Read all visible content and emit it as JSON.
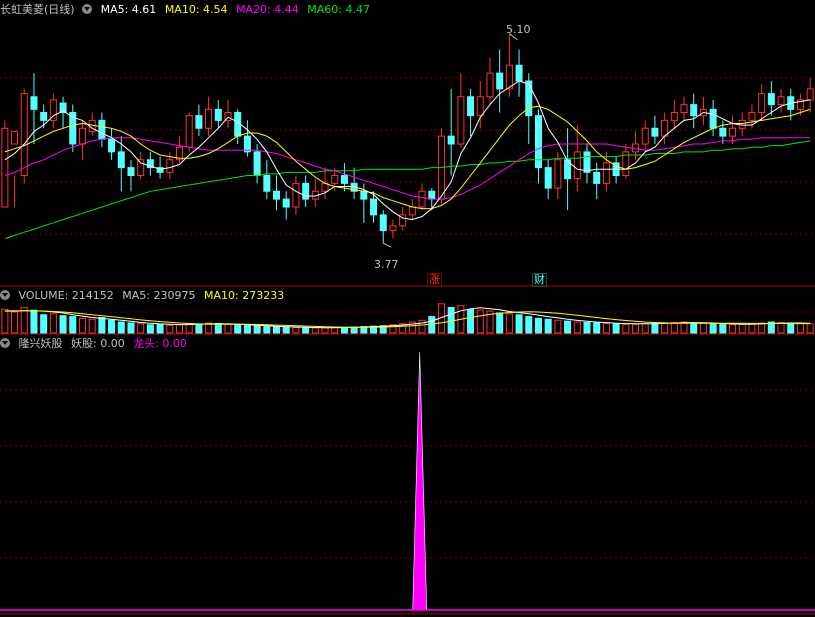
{
  "colors": {
    "up": "#ff3232",
    "down": "#54ffff",
    "ma5": "#ffffff",
    "ma10": "#ffff00",
    "ma20": "#ff00ff",
    "ma60": "#00e600",
    "grid": "#7a0000",
    "text": "#c0c0c0",
    "magenta": "#ff00ff"
  },
  "header_price": {
    "title": "长虹美菱(日线)",
    "ma5": "MA5: 4.61",
    "ma10": "MA10: 4.54",
    "ma20": "MA20: 4.44",
    "ma60": "MA60: 4.47"
  },
  "header_volume": {
    "label": "VOLUME: 214152",
    "ma5": "MA5: 230975",
    "ma10": "MA10: 273233"
  },
  "header_indicator": {
    "name": "隆兴妖股",
    "yaogu": "妖股: 0.00",
    "longtou": "龙头: 0.00"
  },
  "annotations": {
    "high_label": "5.10",
    "low_label": "3.77",
    "tag_zhang": "涨",
    "tag_cai": "财"
  },
  "chart_data": [
    {
      "type": "candlestick",
      "ylim": [
        3.6,
        5.2
      ],
      "high": 5.1,
      "low": 3.77,
      "candles": [
        [
          4.0,
          4.5,
          4.3,
          4.55
        ],
        [
          4.4,
          4.48,
          4.0,
          4.2
        ],
        [
          4.2,
          4.72,
          4.15,
          4.75
        ],
        [
          4.7,
          4.62,
          4.4,
          4.85
        ],
        [
          4.6,
          4.55,
          4.5,
          4.65
        ],
        [
          4.55,
          4.68,
          4.5,
          4.72
        ],
        [
          4.66,
          4.6,
          4.5,
          4.7
        ],
        [
          4.6,
          4.4,
          4.35,
          4.65
        ],
        [
          4.4,
          4.5,
          4.3,
          4.55
        ],
        [
          4.48,
          4.55,
          4.45,
          4.6
        ],
        [
          4.55,
          4.43,
          4.38,
          4.6
        ],
        [
          4.43,
          4.35,
          4.3,
          4.5
        ],
        [
          4.35,
          4.25,
          4.1,
          4.45
        ],
        [
          4.25,
          4.2,
          4.1,
          4.3
        ],
        [
          4.2,
          4.3,
          4.18,
          4.35
        ],
        [
          4.3,
          4.25,
          4.2,
          4.35
        ],
        [
          4.25,
          4.22,
          4.18,
          4.32
        ],
        [
          4.22,
          4.3,
          4.18,
          4.35
        ],
        [
          4.3,
          4.38,
          4.28,
          4.45
        ],
        [
          4.38,
          4.58,
          4.35,
          4.6
        ],
        [
          4.58,
          4.5,
          4.45,
          4.65
        ],
        [
          4.5,
          4.62,
          4.45,
          4.7
        ],
        [
          4.62,
          4.55,
          4.5,
          4.68
        ],
        [
          4.55,
          4.6,
          4.5,
          4.68
        ],
        [
          4.6,
          4.45,
          4.4,
          4.62
        ],
        [
          4.45,
          4.35,
          4.32,
          4.55
        ],
        [
          4.35,
          4.2,
          4.15,
          4.4
        ],
        [
          4.2,
          4.1,
          4.05,
          4.3
        ],
        [
          4.1,
          4.05,
          3.98,
          4.2
        ],
        [
          4.05,
          4.0,
          3.92,
          4.1
        ],
        [
          4.0,
          4.15,
          3.95,
          4.2
        ],
        [
          4.15,
          4.05,
          4.0,
          4.2
        ],
        [
          4.05,
          4.1,
          4.0,
          4.18
        ],
        [
          4.1,
          4.15,
          4.05,
          4.25
        ],
        [
          4.15,
          4.2,
          4.1,
          4.25
        ],
        [
          4.2,
          4.15,
          4.1,
          4.28
        ],
        [
          4.15,
          4.1,
          4.05,
          4.25
        ],
        [
          4.1,
          4.05,
          3.9,
          4.15
        ],
        [
          4.05,
          3.95,
          3.9,
          4.1
        ],
        [
          3.95,
          3.85,
          3.77,
          3.98
        ],
        [
          3.85,
          3.88,
          3.8,
          3.92
        ],
        [
          3.88,
          3.95,
          3.85,
          4.0
        ],
        [
          3.95,
          4.0,
          3.92,
          4.05
        ],
        [
          4.0,
          4.1,
          3.98,
          4.15
        ],
        [
          4.1,
          4.05,
          3.98,
          4.12
        ],
        [
          4.05,
          4.45,
          4.02,
          4.5
        ],
        [
          4.45,
          4.4,
          4.2,
          4.75
        ],
        [
          4.4,
          4.7,
          4.38,
          4.85
        ],
        [
          4.7,
          4.58,
          4.45,
          4.75
        ],
        [
          4.58,
          4.7,
          4.5,
          4.8
        ],
        [
          4.7,
          4.85,
          4.65,
          4.95
        ],
        [
          4.85,
          4.75,
          4.6,
          5.0
        ],
        [
          4.75,
          4.9,
          4.7,
          5.1
        ],
        [
          4.9,
          4.8,
          4.7,
          5.0
        ],
        [
          4.8,
          4.58,
          4.4,
          4.85
        ],
        [
          4.58,
          4.25,
          4.15,
          4.62
        ],
        [
          4.25,
          4.12,
          4.05,
          4.3
        ],
        [
          4.12,
          4.3,
          4.05,
          4.35
        ],
        [
          4.3,
          4.18,
          3.98,
          4.5
        ],
        [
          4.18,
          4.35,
          4.1,
          4.52
        ],
        [
          4.35,
          4.22,
          4.15,
          4.4
        ],
        [
          4.22,
          4.15,
          4.05,
          4.28
        ],
        [
          4.15,
          4.28,
          4.1,
          4.35
        ],
        [
          4.28,
          4.2,
          4.15,
          4.32
        ],
        [
          4.2,
          4.35,
          4.18,
          4.4
        ],
        [
          4.35,
          4.4,
          4.3,
          4.48
        ],
        [
          4.4,
          4.5,
          4.35,
          4.55
        ],
        [
          4.5,
          4.45,
          4.4,
          4.58
        ],
        [
          4.45,
          4.55,
          4.4,
          4.6
        ],
        [
          4.55,
          4.6,
          4.5,
          4.68
        ],
        [
          4.6,
          4.65,
          4.55,
          4.7
        ],
        [
          4.65,
          4.58,
          4.5,
          4.72
        ],
        [
          4.58,
          4.62,
          4.52,
          4.7
        ],
        [
          4.62,
          4.5,
          4.45,
          4.68
        ],
        [
          4.5,
          4.45,
          4.4,
          4.55
        ],
        [
          4.45,
          4.5,
          4.4,
          4.58
        ],
        [
          4.5,
          4.55,
          4.45,
          4.6
        ],
        [
          4.55,
          4.6,
          4.5,
          4.65
        ],
        [
          4.6,
          4.72,
          4.55,
          4.78
        ],
        [
          4.72,
          4.65,
          4.58,
          4.8
        ],
        [
          4.65,
          4.7,
          4.6,
          4.75
        ],
        [
          4.7,
          4.62,
          4.55,
          4.75
        ],
        [
          4.62,
          4.68,
          4.58,
          4.72
        ],
        [
          4.68,
          4.75,
          4.6,
          4.82
        ]
      ],
      "ma5": [
        4.3,
        4.34,
        4.4,
        4.48,
        4.52,
        4.58,
        4.61,
        4.57,
        4.55,
        4.5,
        4.47,
        4.44,
        4.4,
        4.35,
        4.28,
        4.26,
        4.24,
        4.25,
        4.27,
        4.33,
        4.38,
        4.44,
        4.5,
        4.57,
        4.54,
        4.49,
        4.43,
        4.35,
        4.24,
        4.14,
        4.1,
        4.07,
        4.07,
        4.09,
        4.13,
        4.13,
        4.13,
        4.11,
        4.08,
        4.02,
        3.97,
        3.93,
        3.92,
        3.94,
        3.99,
        4.07,
        4.16,
        4.34,
        4.44,
        4.57,
        4.65,
        4.72,
        4.76,
        4.8,
        4.78,
        4.66,
        4.5,
        4.41,
        4.29,
        4.24,
        4.23,
        4.24,
        4.24,
        4.24,
        4.24,
        4.28,
        4.35,
        4.38,
        4.45,
        4.5,
        4.55,
        4.56,
        4.6,
        4.59,
        4.56,
        4.53,
        4.52,
        4.52,
        4.56,
        4.6,
        4.64,
        4.66,
        4.67,
        4.68
      ],
      "ma10": [
        4.35,
        4.37,
        4.39,
        4.42,
        4.45,
        4.48,
        4.5,
        4.52,
        4.53,
        4.52,
        4.51,
        4.5,
        4.48,
        4.45,
        4.4,
        4.36,
        4.33,
        4.32,
        4.31,
        4.31,
        4.32,
        4.34,
        4.37,
        4.41,
        4.45,
        4.47,
        4.47,
        4.45,
        4.41,
        4.35,
        4.29,
        4.24,
        4.19,
        4.15,
        4.13,
        4.12,
        4.11,
        4.1,
        4.09,
        4.06,
        4.04,
        4.02,
        4.0,
        3.99,
        3.99,
        4.01,
        4.05,
        4.12,
        4.2,
        4.28,
        4.36,
        4.44,
        4.52,
        4.58,
        4.63,
        4.64,
        4.62,
        4.58,
        4.54,
        4.48,
        4.42,
        4.35,
        4.3,
        4.26,
        4.24,
        4.25,
        4.27,
        4.29,
        4.33,
        4.37,
        4.41,
        4.44,
        4.47,
        4.5,
        4.52,
        4.53,
        4.53,
        4.54,
        4.55,
        4.56,
        4.57,
        4.58,
        4.6,
        4.62
      ],
      "ma20": [
        4.2,
        4.22,
        4.25,
        4.28,
        4.3,
        4.33,
        4.36,
        4.38,
        4.4,
        4.42,
        4.43,
        4.44,
        4.44,
        4.44,
        4.43,
        4.42,
        4.41,
        4.4,
        4.39,
        4.38,
        4.37,
        4.36,
        4.36,
        4.36,
        4.36,
        4.36,
        4.36,
        4.35,
        4.34,
        4.32,
        4.3,
        4.28,
        4.26,
        4.24,
        4.23,
        4.21,
        4.19,
        4.17,
        4.15,
        4.13,
        4.11,
        4.09,
        4.07,
        4.06,
        4.05,
        4.05,
        4.06,
        4.08,
        4.11,
        4.14,
        4.18,
        4.22,
        4.26,
        4.3,
        4.34,
        4.37,
        4.39,
        4.4,
        4.4,
        4.4,
        4.4,
        4.4,
        4.4,
        4.39,
        4.38,
        4.37,
        4.36,
        4.36,
        4.37,
        4.38,
        4.39,
        4.4,
        4.4,
        4.41,
        4.42,
        4.42,
        4.43,
        4.43,
        4.44,
        4.44,
        4.44,
        4.44,
        4.44,
        4.44
      ],
      "ma60": [
        3.8,
        3.82,
        3.84,
        3.86,
        3.88,
        3.9,
        3.92,
        3.94,
        3.96,
        3.98,
        4.0,
        4.02,
        4.04,
        4.06,
        4.08,
        4.1,
        4.11,
        4.12,
        4.13,
        4.14,
        4.15,
        4.16,
        4.17,
        4.18,
        4.19,
        4.2,
        4.2,
        4.21,
        4.21,
        4.22,
        4.22,
        4.22,
        4.22,
        4.23,
        4.23,
        4.23,
        4.23,
        4.24,
        4.24,
        4.24,
        4.24,
        4.24,
        4.24,
        4.24,
        4.25,
        4.25,
        4.26,
        4.26,
        4.27,
        4.27,
        4.28,
        4.28,
        4.29,
        4.29,
        4.3,
        4.3,
        4.3,
        4.31,
        4.31,
        4.31,
        4.32,
        4.32,
        4.32,
        4.32,
        4.33,
        4.33,
        4.33,
        4.34,
        4.34,
        4.34,
        4.35,
        4.35,
        4.35,
        4.36,
        4.36,
        4.37,
        4.37,
        4.38,
        4.38,
        4.39,
        4.39,
        4.4,
        4.41,
        4.42
      ]
    },
    {
      "type": "bar",
      "series": "volume",
      "values": [
        260,
        230,
        280,
        250,
        200,
        210,
        190,
        180,
        160,
        150,
        170,
        140,
        120,
        110,
        100,
        90,
        95,
        85,
        90,
        95,
        100,
        110,
        105,
        95,
        90,
        85,
        80,
        75,
        70,
        65,
        60,
        58,
        55,
        55,
        60,
        62,
        65,
        70,
        75,
        80,
        90,
        100,
        120,
        140,
        180,
        320,
        280,
        300,
        260,
        250,
        240,
        220,
        210,
        200,
        180,
        160,
        150,
        140,
        130,
        120,
        115,
        110,
        105,
        100,
        95,
        95,
        100,
        105,
        110,
        115,
        120,
        110,
        105,
        100,
        95,
        90,
        95,
        100,
        110,
        120,
        115,
        110,
        105,
        100
      ],
      "ma5": [
        240,
        240,
        245,
        245,
        240,
        230,
        220,
        200,
        185,
        170,
        160,
        150,
        140,
        128,
        115,
        108,
        100,
        95,
        92,
        92,
        95,
        100,
        102,
        100,
        98,
        92,
        86,
        80,
        75,
        70,
        66,
        62,
        60,
        58,
        58,
        60,
        63,
        66,
        70,
        74,
        80,
        88,
        98,
        110,
        130,
        170,
        208,
        244,
        264,
        276,
        266,
        254,
        236,
        224,
        212,
        196,
        180,
        166,
        150,
        138,
        128,
        120,
        114,
        108,
        103,
        101,
        101,
        102,
        105,
        109,
        114,
        114,
        113,
        110,
        104,
        100,
        97,
        96,
        100,
        105,
        108,
        110,
        110,
        108
      ],
      "ma10": [
        245,
        244,
        243,
        242,
        240,
        236,
        230,
        222,
        212,
        200,
        190,
        180,
        168,
        156,
        144,
        134,
        125,
        118,
        110,
        104,
        99,
        97,
        96,
        96,
        96,
        95,
        93,
        90,
        87,
        83,
        80,
        76,
        72,
        69,
        66,
        64,
        63,
        63,
        64,
        66,
        69,
        74,
        80,
        88,
        98,
        112,
        130,
        150,
        170,
        188,
        204,
        216,
        224,
        230,
        232,
        230,
        224,
        216,
        206,
        194,
        182,
        170,
        158,
        147,
        137,
        128,
        120,
        115,
        111,
        108,
        107,
        107,
        107,
        108,
        108,
        107,
        106,
        105,
        104,
        104,
        104,
        103,
        103,
        103
      ]
    },
    {
      "type": "bar",
      "series": "indicator",
      "values": [
        0,
        0,
        0,
        0,
        0,
        0,
        0,
        0,
        0,
        0,
        0,
        0,
        0,
        0,
        0,
        0,
        0,
        0,
        0,
        0,
        0,
        0,
        0,
        0,
        0,
        0,
        0,
        0,
        0,
        0,
        0,
        0,
        0,
        0,
        0,
        0,
        0,
        0,
        0,
        0,
        0,
        0,
        0,
        0,
        0,
        0,
        0,
        0,
        0,
        0,
        0,
        0,
        0,
        0,
        0,
        0,
        0,
        0,
        0,
        0,
        0,
        0,
        0,
        0,
        0,
        0,
        0,
        0,
        0,
        0,
        0,
        0,
        0,
        0,
        0,
        0,
        0,
        0,
        0,
        0,
        0,
        0,
        0,
        0
      ],
      "spike": {
        "x_fraction": 0.515,
        "value": 1
      }
    }
  ]
}
